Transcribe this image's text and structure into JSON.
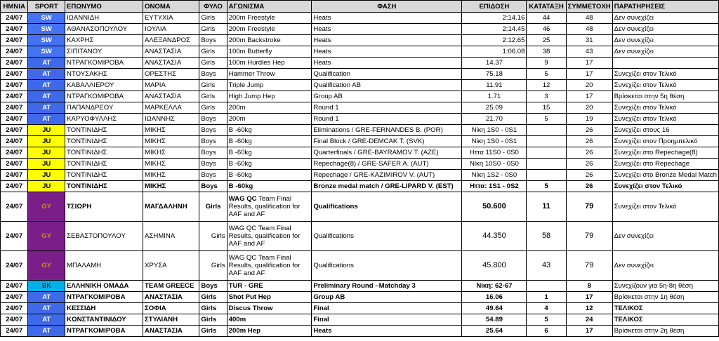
{
  "headers": [
    "ΗΜΝΙΑ",
    "SPORT",
    "ΕΠΩΝΥΜΟ",
    "ΟΝΟΜΑ",
    "ΦΥΛΟ",
    "ΑΓΩΝΙΣΜΑ",
    "ΦΑΣΗ",
    "ΕΠΙΔΟΣΗ",
    "ΚΑΤΑΤΑΞΗ",
    "ΣΥΜΜΕΤΟΧΗ",
    "ΠΑΡΑΤΗΡΗΣΕΙΣ"
  ],
  "sport_colors": {
    "SW": "#4472f2",
    "AT": "#3f69e8",
    "JU": "#ffff00",
    "GY": "#7a1f8a",
    "BK": "#00b0e8"
  },
  "rows": [
    {
      "date": "24/07",
      "sport": "SW",
      "surname": "ΙΩΑΝΝΙΔΗ",
      "name": "ΕΥΤΥΧΙΑ",
      "gender": "Girls",
      "event": "200m Freestyle",
      "phase": "Heats",
      "result": "2:14.16",
      "rank": "44",
      "participants": "48",
      "notes": "Δεν συνεχίζει"
    },
    {
      "date": "24/07",
      "sport": "SW",
      "surname": "ΑΘΑΝΑΣΟΠΟΥΛΟΥ",
      "name": "ΙΟΥΛΙΑ",
      "gender": "Girls",
      "event": "200m Freestyle",
      "phase": "Heats",
      "result": "2:14.45",
      "rank": "46",
      "participants": "48",
      "notes": "Δεν συνεχίζει"
    },
    {
      "date": "24/07",
      "sport": "SW",
      "surname": "ΚΑΧΡΗΣ",
      "name": "ΑΛΕΞΑΝΔΡΟΣ",
      "gender": "Boys",
      "event": "200m Backstroke",
      "phase": "Heats",
      "result": "2:12.65",
      "rank": "25",
      "participants": "31",
      "notes": "Δεν συνεχίζει"
    },
    {
      "date": "24/07",
      "sport": "SW",
      "surname": "ΣΙΠΙΤΑΝΟΥ",
      "name": "ΑΝΑΣΤΑΣΙΑ",
      "gender": "Girls",
      "event": "100m Butterfly",
      "phase": "Heats",
      "result": "1:06.08",
      "rank": "38",
      "participants": "43",
      "notes": "Δεν συνεχίζει"
    },
    {
      "date": "24/07",
      "sport": "AT",
      "surname": "ΝΤΡΑΓΚΟΜΙΡΟΒΑ",
      "name": "ΑΝΑΣΤΑΣΙΑ",
      "gender": "Girls",
      "event": "100m Hurdles Hep",
      "phase": "Heats",
      "result": "14.37",
      "rank": "9",
      "participants": "17",
      "notes": ""
    },
    {
      "date": "24/07",
      "sport": "AT",
      "surname": "ΝΤΟΥΣΑΚΗΣ",
      "name": "ΟΡΕΣΤΗΣ",
      "gender": "Boys",
      "event": "Hammer Throw",
      "phase": "Qualification",
      "result": "75.18",
      "rank": "5",
      "participants": "17",
      "notes": "Συνεχίζει στον Τελικό"
    },
    {
      "date": "24/07",
      "sport": "AT",
      "surname": "ΚΑΒΑΛΛΙΕΡΟΥ",
      "name": "ΜΑΡΙΑ",
      "gender": "Girls",
      "event": "Triple Jump",
      "phase": "Qualification AB",
      "result": "11.91",
      "rank": "12",
      "participants": "20",
      "notes": "Συνεχίζει στον Τελικό"
    },
    {
      "date": "24/07",
      "sport": "AT",
      "surname": "ΝΤΡΑΓΚΟΜΙΡΟΒΑ",
      "name": "ΑΝΑΣΤΑΣΙΑ",
      "gender": "Girls",
      "event": "High Jump Hep",
      "phase": "Group AB",
      "result": "1.71",
      "rank": "3",
      "participants": "17",
      "notes": "Βρίσκεται στην 5η θέση"
    },
    {
      "date": "24/07",
      "sport": "AT",
      "surname": "ΠΑΠΑΝΔΡΕΟΥ",
      "name": "ΜΑΡΚΕΛΛΑ",
      "gender": "Girls",
      "event": "200m",
      "phase": "Round 1",
      "result": "25.09",
      "rank": "15",
      "participants": "20",
      "notes": "Συνεχίζει στον Τελικό"
    },
    {
      "date": "24/07",
      "sport": "AT",
      "surname": "ΚΑΡΥΟΦΥΛΛΗΣ",
      "name": "ΙΩΑΝΝΗΣ",
      "gender": "Boys",
      "event": "200m",
      "phase": "Round 1",
      "result": "21.70",
      "rank": "5",
      "participants": "19",
      "notes": "Συνεχίζει στον Τελικό"
    },
    {
      "date": "24/07",
      "sport": "JU",
      "surname": "ΤΟΝΤΙΝΙΔΗΣ",
      "name": "ΜΙΚΗΣ",
      "gender": "Boys",
      "event": "B -60kg",
      "phase": "Eliminations / GRE-FERNANDES B. (POR)",
      "result": "Νίκη 1S0 - 0S1",
      "rank": "",
      "participants": "26",
      "notes": "Συνεχίζει στους 16"
    },
    {
      "date": "24/07",
      "sport": "JU",
      "surname": "ΤΟΝΤΙΝΙΔΗΣ",
      "name": "ΜΙΚΗΣ",
      "gender": "Boys",
      "event": "B -60kg",
      "phase": "Final Block / GRE-DEMCAK T. (SVK)",
      "result": "Νίκη 1S0 - 0S1",
      "rank": "",
      "participants": "26",
      "notes": "Συνεχίζει στον Προημιτελικό"
    },
    {
      "date": "24/07",
      "sport": "JU",
      "surname": "ΤΟΝΤΙΝΙΔΗΣ",
      "name": "ΜΙΚΗΣ",
      "gender": "Boys",
      "event": "B -60kg",
      "phase": "Quarterfinals / GRE-BAYRAMOV T. (AZE)",
      "result": "Ηττα 11S0 - 0S0",
      "rank": "",
      "participants": "26",
      "notes": "Συνεχίζει στο Repechage(8)"
    },
    {
      "date": "24/07",
      "sport": "JU",
      "surname": "ΤΟΝΤΙΝΙΔΗΣ",
      "name": "ΜΙΚΗΣ",
      "gender": "Boys",
      "event": "B -60kg",
      "phase": "Repechage(8) / GRE-SAFER A. (AUT)",
      "result": "Νίκη 10S0 - 0S0",
      "rank": "",
      "participants": "26",
      "notes": "Συνεχίζει στο Repechage"
    },
    {
      "date": "24/07",
      "sport": "JU",
      "surname": "ΤΟΝΤΙΝΙΔΗΣ",
      "name": "ΜΙΚΗΣ",
      "gender": "Boys",
      "event": "B -60kg",
      "phase": "Repechage / GRE-KAZIMIROV V. (AUT)",
      "result": "Νίκη 1S2 - 0S0",
      "rank": "",
      "participants": "26",
      "notes": "Συνεχίζει στο Bronze Medal Match"
    },
    {
      "date": "24/07",
      "sport": "JU",
      "surname": "ΤΟΝΤΙΝΙΔΗΣ",
      "name": "ΜΙΚΗΣ",
      "gender": "Boys",
      "event": "B -60kg",
      "phase": "Bronze medal match / GRE-LIPARD V. (EST)",
      "result": "Ηττα: 1S1 - 0S2",
      "rank": "5",
      "participants": "26",
      "notes": "Συνεχίζει στον Τελικό"
    },
    {
      "date": "24/07",
      "sport": "GY",
      "surname": "ΤΣΙΩΡΗ",
      "name": "ΜΑΓΔΑΛΗΝΗ",
      "gender": "Girls",
      "event_bold": "WAG QC",
      "event": "Team Final Results, qualification for AAF and AF",
      "phase": "Qualifications",
      "result": "50.600",
      "rank": "11",
      "participants": "79",
      "notes": "Συνεχίζει στον Τελικό"
    },
    {
      "date": "24/07",
      "sport": "GY",
      "surname": "ΣΕΒΑΣΤΟΠΟΥΛΟΥ",
      "name": "ΑΣΗΜΙΝΑ",
      "gender": "Girls",
      "event_bold": "WAG QC",
      "event": "Team Final Results, qualification for AAF and AF",
      "phase": "Qualifications",
      "result": "44.350",
      "rank": "58",
      "participants": "79",
      "notes": "Δεν συνεχίζει"
    },
    {
      "date": "24/07",
      "sport": "GY",
      "surname": "ΜΠΑΛΑΜΗ",
      "name": "ΧΡΥΣΑ",
      "gender": "Girls",
      "event_bold": "WAG QC",
      "event": "Team Final Results, qualification for AAF and AF",
      "phase": "Qualifications",
      "result": "45.800",
      "rank": "43",
      "participants": "79",
      "notes": "Δεν συνεχίζει"
    },
    {
      "date": "24/07",
      "sport": "BK",
      "surname": "ΕΛΛΗΝΙΚΗ ΟΜΑΔΑ",
      "name": "TEAM GREECE",
      "gender": "Boys",
      "event": "TUR - GRE",
      "phase": "Preliminary Round –Matchday 3",
      "result": "Νίκη: 62-67",
      "rank": "",
      "participants": "8",
      "notes": "Συνεχίζουν για 5η-8η θέση"
    },
    {
      "date": "24/07",
      "sport": "AT",
      "surname": "ΝΤΡΑΓΚΟΜΙΡΟΒΑ",
      "name": "ΑΝΑΣΤΑΣΙΑ",
      "gender": "Girls",
      "event": "Shot Put Hep",
      "phase": "Group AB",
      "result": "16.06",
      "rank": "1",
      "participants": "17",
      "notes": "Βρίσκεται στην 1η θέση"
    },
    {
      "date": "24/07",
      "sport": "AT",
      "surname": "ΚΕΣΣΙΔΗ",
      "name": "ΣΟΦΙΑ",
      "gender": "Girls",
      "event": "Discus Throw",
      "phase": "Final",
      "result": "49.64",
      "rank": "4",
      "participants": "12",
      "notes": "ΤΕΛΙΚΟΣ"
    },
    {
      "date": "24/07",
      "sport": "AT",
      "surname": "ΚΩΝΣΤΑΝΤΙΝΙΔΟΥ",
      "name": "ΣΤΥΛΙΑΝΗ",
      "gender": "Girls",
      "event": "400m",
      "phase": "Final",
      "result": "54.89",
      "rank": "5",
      "participants": "24",
      "notes": "ΤΕΛΙΚΟΣ"
    },
    {
      "date": "24/07",
      "sport": "AT",
      "surname": "ΝΤΡΑΓΚΟΜΙΡΟΒΑ",
      "name": "ΑΝΑΣΤΑΣΙΑ",
      "gender": "Girls",
      "event": "200m Hep",
      "phase": "Heats",
      "result": "25.64",
      "rank": "6",
      "participants": "17",
      "notes": "Βρίσκεται στην 2η θέση"
    }
  ]
}
